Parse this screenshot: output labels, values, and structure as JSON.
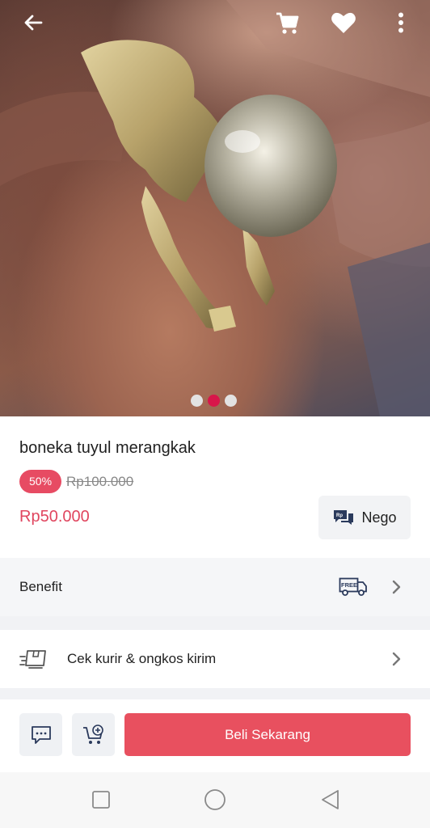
{
  "header": {
    "back_icon": "arrow-left-icon",
    "cart_icon": "shopping-cart-icon",
    "wishlist_icon": "heart-icon",
    "more_icon": "more-vertical-icon"
  },
  "gallery": {
    "image_count": 3,
    "active_index": 1
  },
  "product": {
    "title": "boneka tuyul merangkak",
    "discount_badge": "50%",
    "original_price": "Rp100.000",
    "price": "Rp50.000",
    "nego_label": "Nego"
  },
  "benefit": {
    "label": "Benefit",
    "free_label": "FREE"
  },
  "shipping": {
    "label": "Cek kurir & ongkos kirim"
  },
  "actions": {
    "chat_icon": "chat-icon",
    "add_to_cart_icon": "cart-plus-icon",
    "buy_label": "Beli Sekarang"
  },
  "colors": {
    "accent": "#e8505f",
    "price": "#e0465f",
    "dot_active": "#d8164a"
  }
}
